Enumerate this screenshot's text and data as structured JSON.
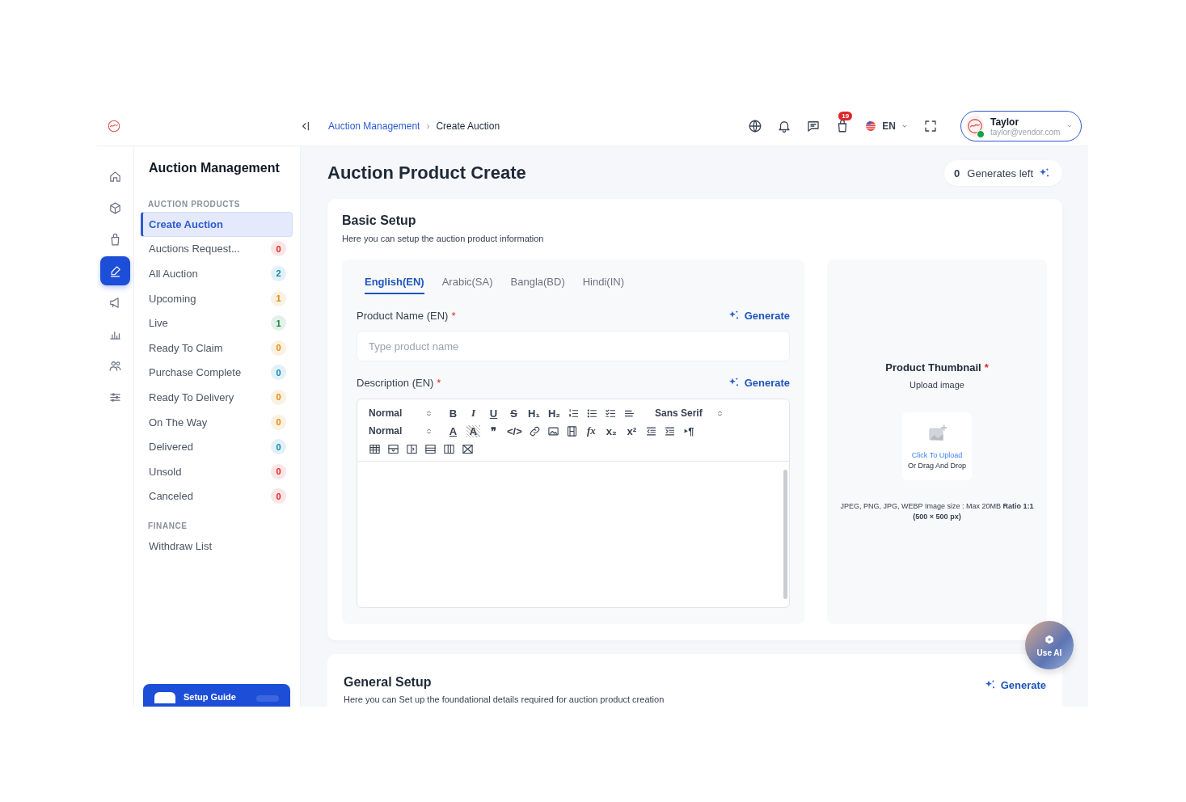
{
  "header": {
    "breadcrumbs": [
      {
        "label": "Auction Management",
        "current": false
      },
      {
        "label": "Create Auction",
        "current": true
      }
    ],
    "separator": "›",
    "cart_badge": "19",
    "language": "EN",
    "user": {
      "name": "Taylor",
      "email": "taylor@vendor.com",
      "online": true
    }
  },
  "rail": {
    "items": [
      {
        "kind": "home",
        "selected": false
      },
      {
        "kind": "box",
        "selected": false
      },
      {
        "kind": "bag",
        "selected": false
      },
      {
        "kind": "pen",
        "selected": true
      },
      {
        "kind": "megaphone",
        "selected": false
      },
      {
        "kind": "chart",
        "selected": false
      },
      {
        "kind": "users",
        "selected": false
      },
      {
        "kind": "sliders",
        "selected": false
      }
    ]
  },
  "menu": {
    "title": "Auction Management",
    "sections": [
      {
        "heading": "AUCTION PRODUCTS",
        "items": [
          {
            "label": "Create Auction",
            "selected": true
          },
          {
            "label": "Auctions Request...",
            "count": "0",
            "color": "#dc2626",
            "selected": false
          },
          {
            "label": "All Auction",
            "count": "2",
            "color": "#0e87b4",
            "selected": false
          },
          {
            "label": "Upcoming",
            "count": "1",
            "color": "#e08a0b",
            "selected": false
          },
          {
            "label": "Live",
            "count": "1",
            "color": "#16894a",
            "selected": false
          },
          {
            "label": "Ready To Claim",
            "count": "0",
            "color": "#e08a0b",
            "selected": false
          },
          {
            "label": "Purchase Complete",
            "count": "0",
            "color": "#0e87b4",
            "selected": false
          },
          {
            "label": "Ready To Delivery",
            "count": "0",
            "color": "#e08a0b",
            "selected": false
          },
          {
            "label": "On The Way",
            "count": "0",
            "color": "#e08a0b",
            "selected": false
          },
          {
            "label": "Delivered",
            "count": "0",
            "color": "#0e87b4",
            "selected": false
          },
          {
            "label": "Unsold",
            "count": "0",
            "color": "#dc2626",
            "selected": false
          },
          {
            "label": "Canceled",
            "count": "0",
            "color": "#dc2626",
            "selected": false
          }
        ]
      },
      {
        "heading": "FINANCE",
        "items": [
          {
            "label": "Withdraw List",
            "selected": false
          }
        ]
      }
    ],
    "setup_guide": "Setup Guide"
  },
  "main": {
    "title": "Auction Product Create",
    "generates": {
      "count": "0",
      "label": "Generates left"
    },
    "basic_setup": {
      "title": "Basic Setup",
      "subtitle": "Here you can setup the auction product information",
      "tabs": [
        {
          "label": "English(EN)",
          "selected": true
        },
        {
          "label": "Arabic(SA)",
          "selected": false
        },
        {
          "label": "Bangla(BD)",
          "selected": false
        },
        {
          "label": "Hindi(IN)",
          "selected": false
        }
      ],
      "product_name": {
        "label": "Product Name (EN)",
        "required_mark": "*",
        "generate": "Generate",
        "placeholder": "Type product name"
      },
      "description": {
        "label": "Description (EN)",
        "required_mark": "*",
        "generate": "Generate",
        "toolbar": [
          [
            {
              "kind": "select",
              "text": "Normal"
            },
            {
              "kind": "bold",
              "text": "B"
            },
            {
              "kind": "italic",
              "text": "I"
            },
            {
              "kind": "underline",
              "text": "U"
            },
            {
              "kind": "strike",
              "text": "S"
            },
            {
              "kind": "text",
              "text": "H₁"
            },
            {
              "kind": "text",
              "text": "H₂"
            },
            {
              "kind": "ordered-list"
            },
            {
              "kind": "bullet-list"
            },
            {
              "kind": "check-list"
            },
            {
              "kind": "align"
            },
            {
              "kind": "select",
              "text": "Sans Serif"
            }
          ],
          [
            {
              "kind": "select",
              "text": "Normal"
            },
            {
              "kind": "underline",
              "text": "A"
            },
            {
              "kind": "shaded",
              "text": "A"
            },
            {
              "kind": "text",
              "text": "❞"
            },
            {
              "kind": "text",
              "text": "</>"
            },
            {
              "kind": "link"
            },
            {
              "kind": "image"
            },
            {
              "kind": "film"
            },
            {
              "kind": "italic",
              "text": "fx"
            },
            {
              "kind": "text",
              "text": "x₂"
            },
            {
              "kind": "text",
              "text": "x²"
            },
            {
              "kind": "outdent"
            },
            {
              "kind": "indent"
            },
            {
              "kind": "text",
              "text": "‣¶"
            }
          ],
          [
            {
              "kind": "table"
            },
            {
              "kind": "row-insert"
            },
            {
              "kind": "col-insert"
            },
            {
              "kind": "row-delete"
            },
            {
              "kind": "col-delete"
            },
            {
              "kind": "table-delete"
            }
          ]
        ]
      }
    },
    "thumbnail": {
      "title": "Product Thumbnail",
      "required_mark": "*",
      "subtitle": "Upload image",
      "upload_link": "Click To Upload",
      "upload_hint": "Or Drag And Drop",
      "note": "JPEG, PNG, JPG, WEBP Image size : Max 20MB **Ratio 1:1 (500 × 500 px)**"
    },
    "general_setup": {
      "title": "General Setup",
      "subtitle": "Here you can Set up the foundational details required for auction product creation",
      "generate": "Generate"
    },
    "use_ai": "Use AI"
  }
}
